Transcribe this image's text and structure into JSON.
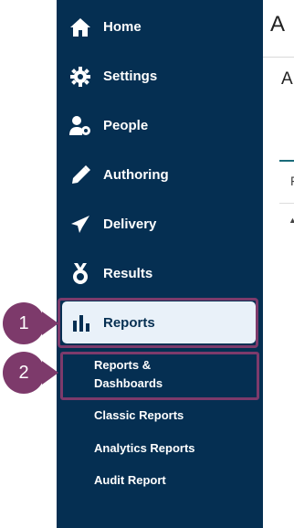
{
  "sidebar": {
    "items": [
      {
        "label": "Home",
        "icon": "home-icon"
      },
      {
        "label": "Settings",
        "icon": "gear-icon"
      },
      {
        "label": "People",
        "icon": "people-settings-icon"
      },
      {
        "label": "Authoring",
        "icon": "pencil-icon"
      },
      {
        "label": "Delivery",
        "icon": "paper-plane-icon"
      },
      {
        "label": "Results",
        "icon": "medal-icon"
      },
      {
        "label": "Reports",
        "icon": "bar-chart-icon"
      }
    ],
    "sub_items": [
      {
        "label_line1": "Reports &",
        "label_line2": "Dashboards"
      },
      {
        "label": "Classic Reports"
      },
      {
        "label": "Analytics Reports"
      },
      {
        "label": "Audit Report"
      }
    ]
  },
  "callouts": {
    "first": "1",
    "second": "2"
  },
  "main": {
    "title_partial": "A",
    "subtitle_partial": "A",
    "label_partial": "F"
  },
  "colors": {
    "sidebar": "#052f52",
    "active_bg": "#e9f1f9",
    "callout": "#7d3a6b",
    "accent": "#1a6b7a"
  }
}
